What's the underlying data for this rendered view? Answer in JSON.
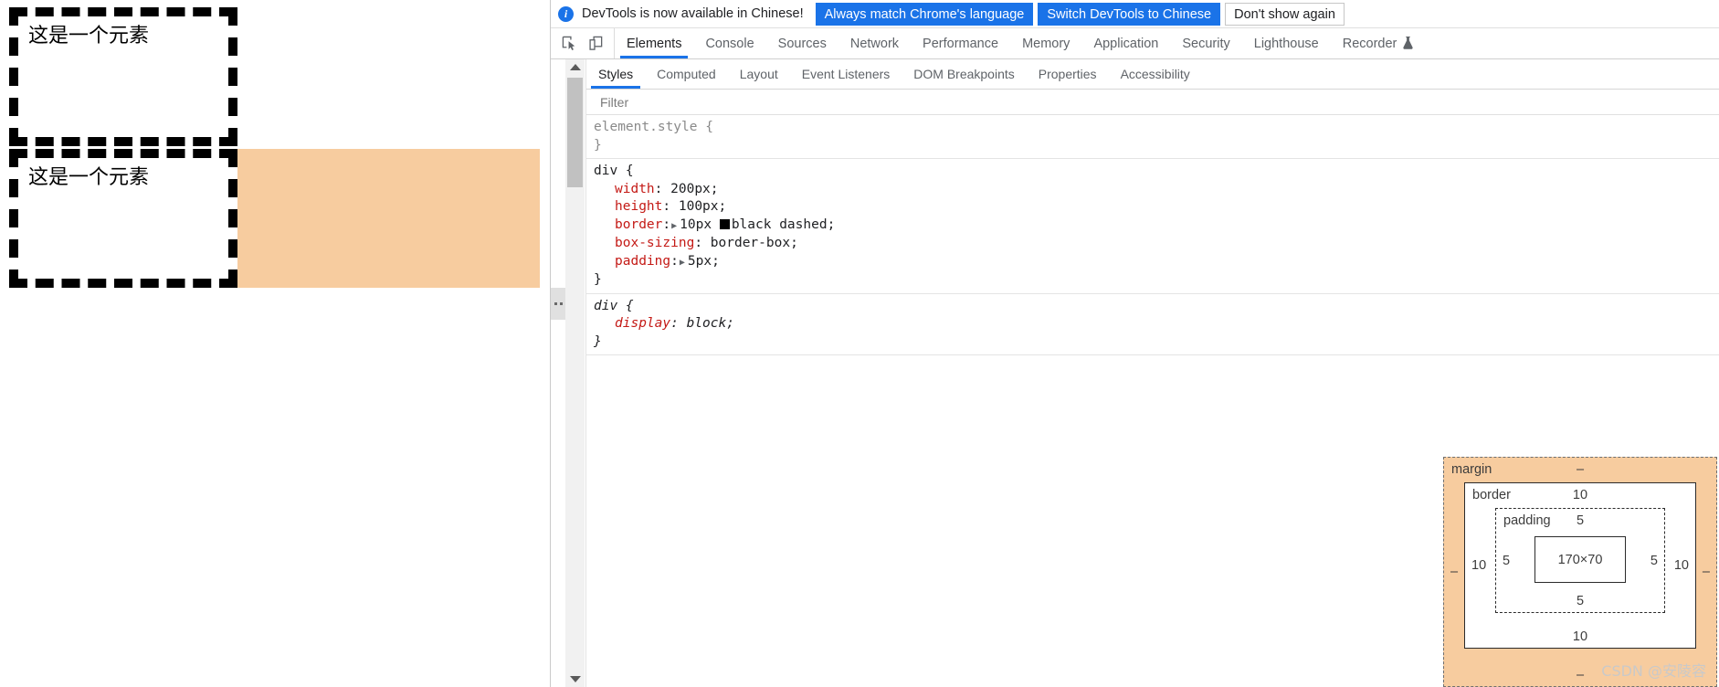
{
  "page": {
    "boxes": [
      {
        "text": "这是一个元素"
      },
      {
        "text": "这是一个元素"
      }
    ]
  },
  "infobar": {
    "icon": "info-icon",
    "message": "DevTools is now available in Chinese!",
    "buttons": [
      {
        "label": "Always match Chrome's language",
        "style": "primary"
      },
      {
        "label": "Switch DevTools to Chinese",
        "style": "primary"
      },
      {
        "label": "Don't show again",
        "style": "secondary"
      }
    ]
  },
  "toolbar": {
    "inspect_icon": "inspect-element-icon",
    "device_icon": "device-toolbar-icon",
    "tabs": [
      {
        "label": "Elements",
        "active": true
      },
      {
        "label": "Console",
        "active": false
      },
      {
        "label": "Sources",
        "active": false
      },
      {
        "label": "Network",
        "active": false
      },
      {
        "label": "Performance",
        "active": false
      },
      {
        "label": "Memory",
        "active": false
      },
      {
        "label": "Application",
        "active": false
      },
      {
        "label": "Security",
        "active": false
      },
      {
        "label": "Lighthouse",
        "active": false
      },
      {
        "label": "Recorder",
        "active": false,
        "icon": "experiment-flask-icon",
        "glyph": "⚗"
      }
    ]
  },
  "sidebar": {
    "tabs": [
      {
        "label": "Styles",
        "active": true
      },
      {
        "label": "Computed",
        "active": false
      },
      {
        "label": "Layout",
        "active": false
      },
      {
        "label": "Event Listeners",
        "active": false
      },
      {
        "label": "DOM Breakpoints",
        "active": false
      },
      {
        "label": "Properties",
        "active": false
      },
      {
        "label": "Accessibility",
        "active": false
      }
    ],
    "filter": {
      "placeholder": "Filter",
      "value": ""
    }
  },
  "styles": {
    "rules": [
      {
        "selector": "element.style",
        "selector_color": "#8a8a8a",
        "inherited": false,
        "declarations": []
      },
      {
        "selector": "div",
        "selector_color": "#202124",
        "inherited": false,
        "declarations": [
          {
            "name": "width",
            "value": "200px",
            "expandable": false
          },
          {
            "name": "height",
            "value": "100px",
            "expandable": false
          },
          {
            "name": "border",
            "value": "10px",
            "expandable": true,
            "swatch": "#000000",
            "value_tail": "black dashed"
          },
          {
            "name": "box-sizing",
            "value": "border-box",
            "expandable": false
          },
          {
            "name": "padding",
            "value": "5px",
            "expandable": true
          }
        ]
      },
      {
        "selector": "div",
        "selector_color": "#202124",
        "inherited": true,
        "declarations": [
          {
            "name": "display",
            "value": "block",
            "expandable": false
          }
        ]
      }
    ]
  },
  "box_model": {
    "margin": {
      "label": "margin",
      "top": "–",
      "right": "–",
      "bottom": "–",
      "left": "–"
    },
    "border": {
      "label": "border",
      "top": "10",
      "right": "10",
      "bottom": "10",
      "left": "10"
    },
    "padding": {
      "label": "padding",
      "top": "5",
      "right": "5",
      "bottom": "5",
      "left": "5"
    },
    "content": {
      "size": "170×70"
    },
    "colors": {
      "margin_fill": "#f7cc9f",
      "border_fill": "#ffffff",
      "content_fill": "#ffffff"
    }
  },
  "scrollbar": {
    "up_arrow": "scroll-up-arrow-icon",
    "down_arrow": "scroll-down-arrow-icon"
  },
  "watermark": {
    "text": "CSDN @安陵容"
  }
}
